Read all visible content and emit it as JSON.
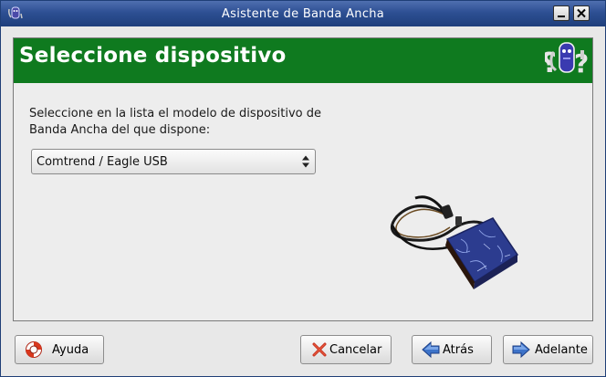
{
  "window": {
    "title": "Asistente de Banda Ancha",
    "icon": "wizard-app-icon",
    "controls": [
      "minimize-icon",
      "close-icon"
    ]
  },
  "header": {
    "title": "Seleccione dispositivo",
    "icon": "device-question-icon",
    "background": "#0f7a1f"
  },
  "main": {
    "instruction": "Seleccione en la lista el modelo de dispositivo de Banda Ancha del que dispone:",
    "device_select": {
      "value": "Comtrend / Eagle USB"
    },
    "device_image": "usb-modem-image"
  },
  "buttons": {
    "help": "Ayuda",
    "cancel": "Cancelar",
    "back": "Atrás",
    "forward": "Adelante"
  },
  "colors": {
    "titlebar": "#2d4f93",
    "header_green": "#0f7a1f",
    "back_arrow": "#3d73c9",
    "cancel_x": "#c62f1e"
  }
}
